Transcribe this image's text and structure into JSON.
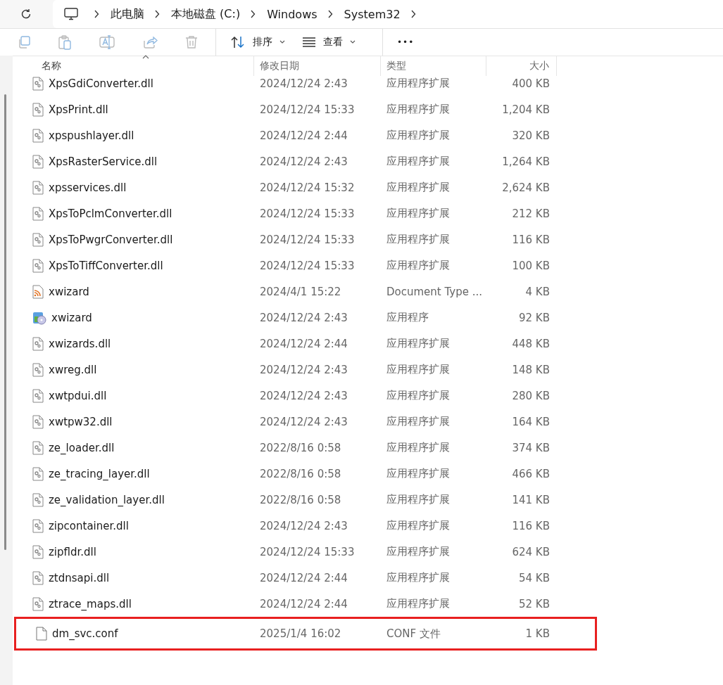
{
  "breadcrumb": [
    "此电脑",
    "本地磁盘 (C:)",
    "Windows",
    "System32"
  ],
  "toolbar": {
    "sort_label": "排序",
    "view_label": "查看",
    "more": "•••"
  },
  "columns": [
    "名称",
    "修改日期",
    "类型",
    "大小"
  ],
  "rows": [
    {
      "kind": "dll",
      "name": "XpsGdiConverter.dll",
      "date": "2024/12/24 2:43",
      "type": "应用程序扩展",
      "size": "400 KB",
      "highlighted": false
    },
    {
      "kind": "dll",
      "name": "XpsPrint.dll",
      "date": "2024/12/24 15:33",
      "type": "应用程序扩展",
      "size": "1,204 KB",
      "highlighted": false
    },
    {
      "kind": "dll",
      "name": "xpspushlayer.dll",
      "date": "2024/12/24 2:44",
      "type": "应用程序扩展",
      "size": "320 KB",
      "highlighted": false
    },
    {
      "kind": "dll",
      "name": "XpsRasterService.dll",
      "date": "2024/12/24 2:43",
      "type": "应用程序扩展",
      "size": "1,264 KB",
      "highlighted": false
    },
    {
      "kind": "dll",
      "name": "xpsservices.dll",
      "date": "2024/12/24 15:32",
      "type": "应用程序扩展",
      "size": "2,624 KB",
      "highlighted": false
    },
    {
      "kind": "dll",
      "name": "XpsToPclmConverter.dll",
      "date": "2024/12/24 15:33",
      "type": "应用程序扩展",
      "size": "212 KB",
      "highlighted": false
    },
    {
      "kind": "dll",
      "name": "XpsToPwgrConverter.dll",
      "date": "2024/12/24 15:33",
      "type": "应用程序扩展",
      "size": "116 KB",
      "highlighted": false
    },
    {
      "kind": "dll",
      "name": "XpsToTiffConverter.dll",
      "date": "2024/12/24 15:33",
      "type": "应用程序扩展",
      "size": "100 KB",
      "highlighted": false
    },
    {
      "kind": "feed",
      "name": "xwizard",
      "date": "2024/4/1 15:22",
      "type": "Document Type ...",
      "size": "4 KB",
      "highlighted": false
    },
    {
      "kind": "exe",
      "name": "xwizard",
      "date": "2024/12/24 2:43",
      "type": "应用程序",
      "size": "92 KB",
      "highlighted": false
    },
    {
      "kind": "dll",
      "name": "xwizards.dll",
      "date": "2024/12/24 2:44",
      "type": "应用程序扩展",
      "size": "448 KB",
      "highlighted": false
    },
    {
      "kind": "dll",
      "name": "xwreg.dll",
      "date": "2024/12/24 2:43",
      "type": "应用程序扩展",
      "size": "148 KB",
      "highlighted": false
    },
    {
      "kind": "dll",
      "name": "xwtpdui.dll",
      "date": "2024/12/24 2:43",
      "type": "应用程序扩展",
      "size": "280 KB",
      "highlighted": false
    },
    {
      "kind": "dll",
      "name": "xwtpw32.dll",
      "date": "2024/12/24 2:43",
      "type": "应用程序扩展",
      "size": "164 KB",
      "highlighted": false
    },
    {
      "kind": "dll",
      "name": "ze_loader.dll",
      "date": "2022/8/16 0:58",
      "type": "应用程序扩展",
      "size": "374 KB",
      "highlighted": false
    },
    {
      "kind": "dll",
      "name": "ze_tracing_layer.dll",
      "date": "2022/8/16 0:58",
      "type": "应用程序扩展",
      "size": "466 KB",
      "highlighted": false
    },
    {
      "kind": "dll",
      "name": "ze_validation_layer.dll",
      "date": "2022/8/16 0:58",
      "type": "应用程序扩展",
      "size": "141 KB",
      "highlighted": false
    },
    {
      "kind": "dll",
      "name": "zipcontainer.dll",
      "date": "2024/12/24 2:43",
      "type": "应用程序扩展",
      "size": "116 KB",
      "highlighted": false
    },
    {
      "kind": "dll",
      "name": "zipfldr.dll",
      "date": "2024/12/24 15:33",
      "type": "应用程序扩展",
      "size": "624 KB",
      "highlighted": false
    },
    {
      "kind": "dll",
      "name": "ztdnsapi.dll",
      "date": "2024/12/24 2:44",
      "type": "应用程序扩展",
      "size": "54 KB",
      "highlighted": false
    },
    {
      "kind": "dll",
      "name": "ztrace_maps.dll",
      "date": "2024/12/24 2:44",
      "type": "应用程序扩展",
      "size": "52 KB",
      "highlighted": false
    },
    {
      "kind": "file",
      "name": "dm_svc.conf",
      "date": "2025/1/4 16:02",
      "type": "CONF 文件",
      "size": "1 KB",
      "highlighted": true
    }
  ]
}
